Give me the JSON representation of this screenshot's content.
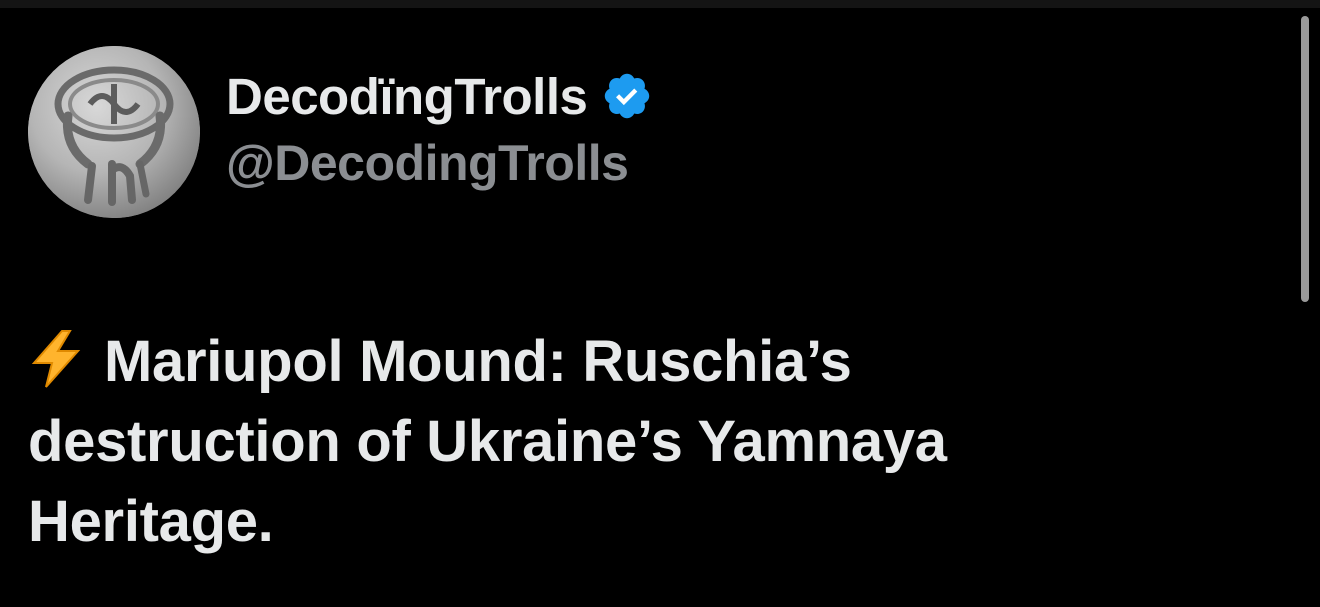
{
  "tweet": {
    "author": {
      "display_name": "DecodïngTrolls",
      "handle": "@DecodingTrolls",
      "verified": true,
      "verified_icon": "verified-badge-icon",
      "avatar_icon": "engraved-seal-avatar"
    },
    "text_icon": "high-voltage-icon",
    "text": "Mariupol Mound: Ruschia’s destruction of Ukraine’s Yamnaya Heritage."
  },
  "colors": {
    "background": "#000000",
    "primary_text": "#e7e9ea",
    "secondary_text": "#8b8e92",
    "verified_blue": "#1d9bf0",
    "bolt_yellow": "#ffb42d",
    "scrollbar": "#9a9a9a"
  }
}
